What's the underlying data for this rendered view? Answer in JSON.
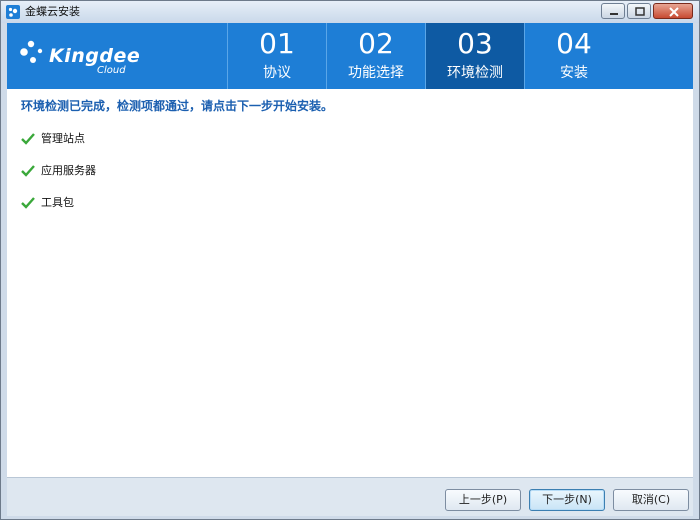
{
  "window": {
    "title": "金蝶云安装"
  },
  "header": {
    "logo_name": "Kingdee",
    "logo_sub": "Cloud",
    "steps": [
      {
        "num": "01",
        "label": "协议"
      },
      {
        "num": "02",
        "label": "功能选择"
      },
      {
        "num": "03",
        "label": "环境检测",
        "active": true
      },
      {
        "num": "04",
        "label": "安装"
      }
    ]
  },
  "content": {
    "status_message": "环境检测已完成，检测项都通过，请点击下一步开始安装。",
    "checks": [
      {
        "label": "管理站点",
        "icon": "check-icon"
      },
      {
        "label": "应用服务器",
        "icon": "check-icon"
      },
      {
        "label": "工具包",
        "icon": "check-icon"
      }
    ]
  },
  "footer": {
    "prev_label": "上一步(P)",
    "next_label": "下一步(N)",
    "cancel_label": "取消(C)"
  },
  "colors": {
    "header_bg": "#1e7ed6",
    "active_step_bg": "#0e5aa3",
    "status_text": "#1b5fb0",
    "check_green": "#3aa83a"
  }
}
